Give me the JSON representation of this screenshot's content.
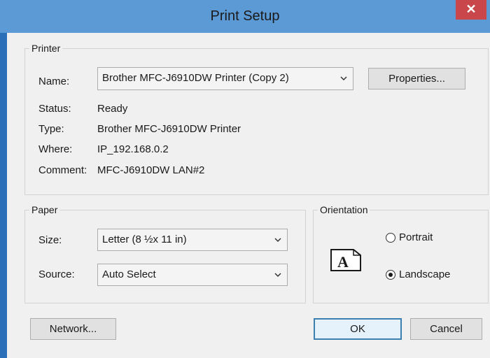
{
  "window": {
    "title": "Print Setup",
    "close_label": "✕"
  },
  "printer": {
    "legend": "Printer",
    "name_label": "Name:",
    "name_value": "Brother MFC-J6910DW Printer (Copy 2)",
    "properties_label": "Properties...",
    "status_label": "Status:",
    "status_value": "Ready",
    "type_label": "Type:",
    "type_value": "Brother MFC-J6910DW Printer",
    "where_label": "Where:",
    "where_value": "IP_192.168.0.2",
    "comment_label": "Comment:",
    "comment_value": "MFC-J6910DW LAN#2"
  },
  "paper": {
    "legend": "Paper",
    "size_label": "Size:",
    "size_value": "Letter (8 ½x 11 in)",
    "source_label": "Source:",
    "source_value": "Auto Select"
  },
  "orientation": {
    "legend": "Orientation",
    "icon_letter": "A",
    "portrait_label": "Portrait",
    "landscape_label": "Landscape",
    "selected": "Landscape"
  },
  "footer": {
    "network_label": "Network...",
    "ok_label": "OK",
    "cancel_label": "Cancel"
  },
  "icons": {
    "close": "close-icon",
    "dropdown": "chevron-down-icon",
    "orientation": "landscape-page-icon"
  },
  "colors": {
    "title_bar": "#5c9ad6",
    "close_button": "#c9474a",
    "dialog_background": "#f0f0f0",
    "default_button_border": "#3c7fb1"
  }
}
